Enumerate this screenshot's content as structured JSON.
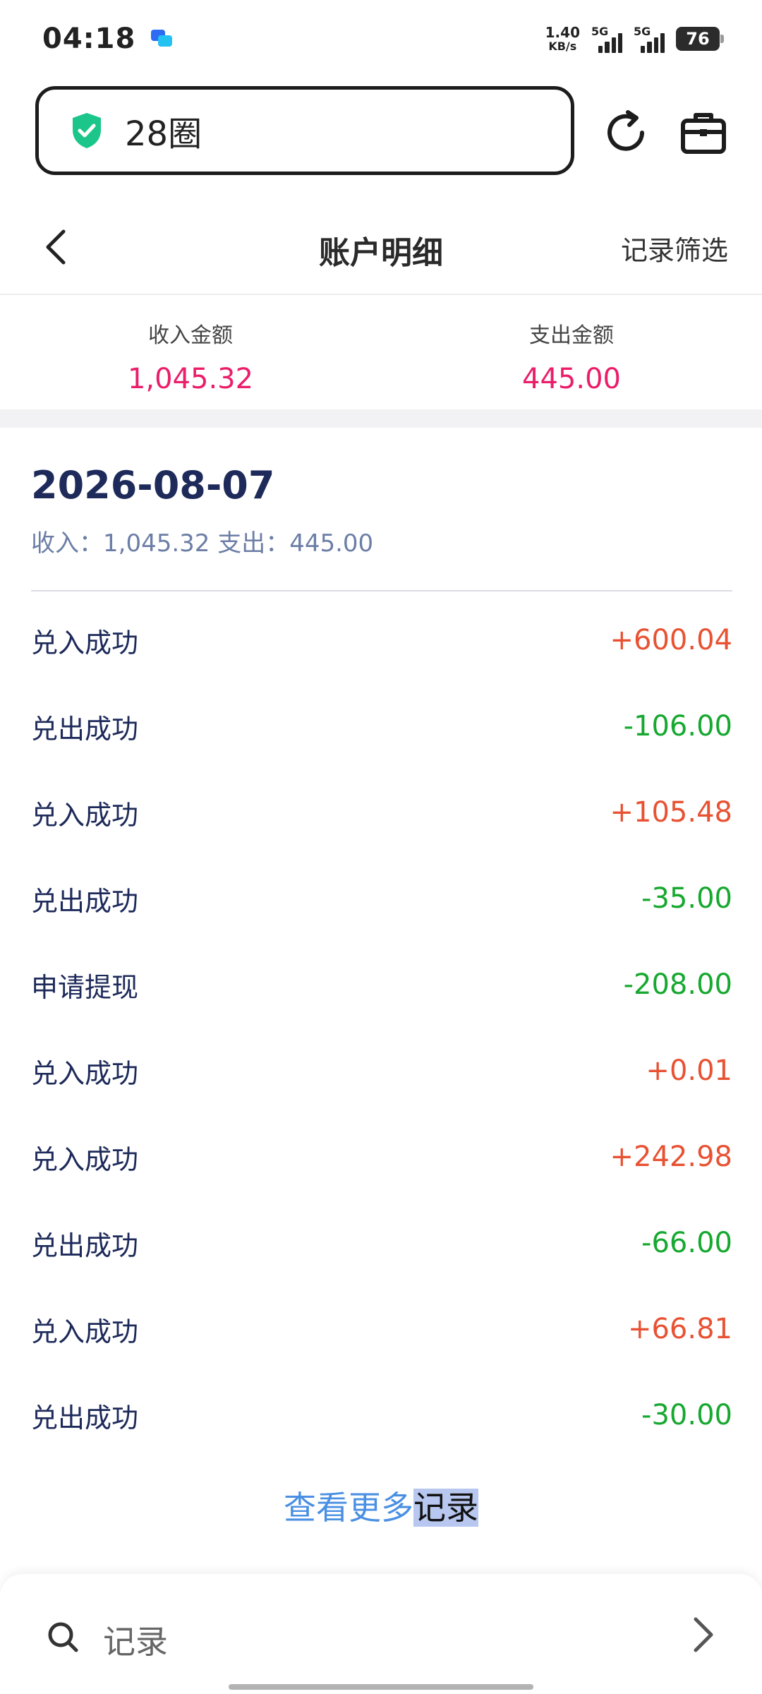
{
  "status_bar": {
    "time": "04:18",
    "net_speed_value": "1.40",
    "net_speed_unit": "KB/s",
    "signal1_label": "5G",
    "signal2_label": "5G",
    "battery": "76"
  },
  "address_bar": {
    "text": "28圈"
  },
  "header": {
    "title": "账户明细",
    "filter_label": "记录筛选"
  },
  "summary": {
    "income_label": "收入金额",
    "income_value": "1,045.32",
    "expense_label": "支出金额",
    "expense_value": "445.00"
  },
  "date_group": {
    "date": "2026-08-07",
    "subtotal": "收入：1,045.32 支出：445.00"
  },
  "transactions": [
    {
      "label": "兑入成功",
      "amount": "+600.04",
      "kind": "income"
    },
    {
      "label": "兑出成功",
      "amount": "-106.00",
      "kind": "expense"
    },
    {
      "label": "兑入成功",
      "amount": "+105.48",
      "kind": "income"
    },
    {
      "label": "兑出成功",
      "amount": "-35.00",
      "kind": "expense"
    },
    {
      "label": "申请提现",
      "amount": "-208.00",
      "kind": "expense"
    },
    {
      "label": "兑入成功",
      "amount": "+0.01",
      "kind": "income"
    },
    {
      "label": "兑入成功",
      "amount": "+242.98",
      "kind": "income"
    },
    {
      "label": "兑出成功",
      "amount": "-66.00",
      "kind": "expense"
    },
    {
      "label": "兑入成功",
      "amount": "+66.81",
      "kind": "income"
    },
    {
      "label": "兑出成功",
      "amount": "-30.00",
      "kind": "expense"
    }
  ],
  "more_link": {
    "part1": "查看更多",
    "part2": "记录"
  },
  "bottom_search": {
    "text": "记录"
  },
  "colors": {
    "income": "#e85233",
    "expense": "#16a82f",
    "summary_value": "#ea1e6a",
    "link": "#4a8fe3",
    "shield": "#1cc68a"
  },
  "icons": {
    "status_message": "message-icon",
    "address_security": "shield-check-icon",
    "reload": "reload-icon",
    "toolbox": "toolbox-icon",
    "back": "chevron-left-icon",
    "search": "search-icon",
    "forward": "chevron-right-icon"
  }
}
